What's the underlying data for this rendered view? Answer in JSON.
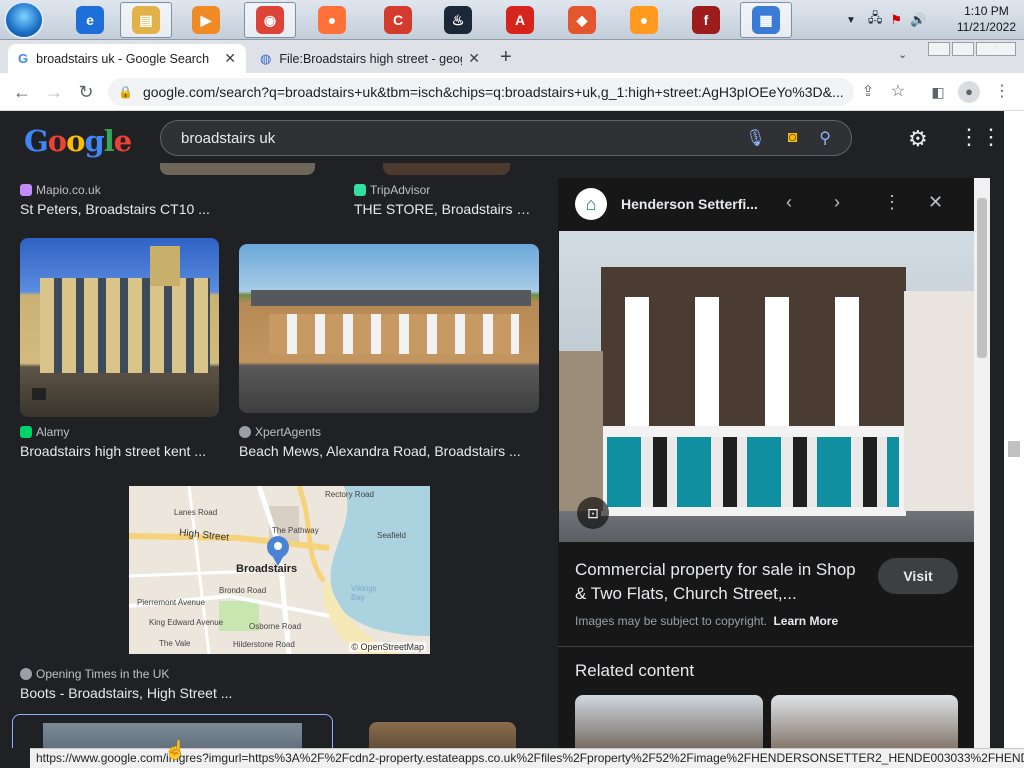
{
  "taskbar": {
    "apps": [
      {
        "name": "internet-explorer",
        "glyph": "e",
        "color": "#1d6ed8"
      },
      {
        "name": "file-explorer",
        "glyph": "▤",
        "color": "#e2b24a"
      },
      {
        "name": "media-player",
        "glyph": "▶",
        "color": "#f08a24"
      },
      {
        "name": "chrome",
        "glyph": "◉",
        "color": "#db4437"
      },
      {
        "name": "firefox",
        "glyph": "●",
        "color": "#ff7139"
      },
      {
        "name": "ccleaner",
        "glyph": "C",
        "color": "#d33b2c"
      },
      {
        "name": "steam",
        "glyph": "♨",
        "color": "#1b2838"
      },
      {
        "name": "acrobat",
        "glyph": "A",
        "color": "#d4241c"
      },
      {
        "name": "scratch",
        "glyph": "◆",
        "color": "#e4572e"
      },
      {
        "name": "firefox-dev",
        "glyph": "●",
        "color": "#ff9a1f"
      },
      {
        "name": "flash",
        "glyph": "f",
        "color": "#9d1c1c"
      },
      {
        "name": "control-panel",
        "glyph": "▦",
        "color": "#3a7bd5"
      }
    ],
    "time": "1:10 PM",
    "date": "11/21/2022"
  },
  "tabs": [
    {
      "title": "broadstairs uk - Google Search"
    },
    {
      "title": "File:Broadstairs high street - geograph"
    }
  ],
  "toolbar": {
    "url": "google.com/search?q=broadstairs+uk&tbm=isch&chips=q:broadstairs+uk,g_1:high+street:AgH3pIOEeYo%3D&..."
  },
  "google": {
    "logo": "Google",
    "query": "broadstairs uk"
  },
  "results": [
    {
      "source": "Mapio.co.uk",
      "caption": "St Peters, Broadstairs CT10 ...",
      "fav": "#c58af9"
    },
    {
      "source": "TripAdvisor",
      "caption": "THE STORE, Broadstairs - ...",
      "fav": "#34e0a1"
    },
    {
      "source": "Alamy",
      "caption": "Broadstairs high street kent ...",
      "fav": "#00d26a"
    },
    {
      "source": "XpertAgents",
      "caption": "Beach Mews, Alexandra Road, Broadstairs ...",
      "fav": "#9aa0a6"
    },
    {
      "source": "Opening Times in the UK",
      "caption": "Boots - Broadstairs, High Street ...",
      "fav": "#9aa0a6"
    }
  ],
  "map": {
    "labels": [
      "High Street",
      "Broadstairs",
      "Rectory Road",
      "The Pathway",
      "Vikings Bay",
      "Pierremont Avenue",
      "King Edward Avenue",
      "Lanes Road",
      "Osborne Road",
      "Brondo Road",
      "Seafield",
      "The Vale",
      "Hilderstone Road"
    ],
    "credit": "© OpenStreetMap"
  },
  "panel": {
    "site": "Henderson Setterfi...",
    "title": "Commercial property for sale in Shop & Two Flats, Church Street,...",
    "visit": "Visit",
    "copyright": "Images may be subject to copyright.",
    "learn_more": "Learn More",
    "related": "Related content"
  },
  "status_url": "https://www.google.com/imgres?imgurl=https%3A%2F%2Fcdn2-property.estateapps.co.uk%2Ffiles%2Fproperty%2F52%2Fimage%2FHENDERSONSETTER2_HENDE003033%2FHENDER..."
}
